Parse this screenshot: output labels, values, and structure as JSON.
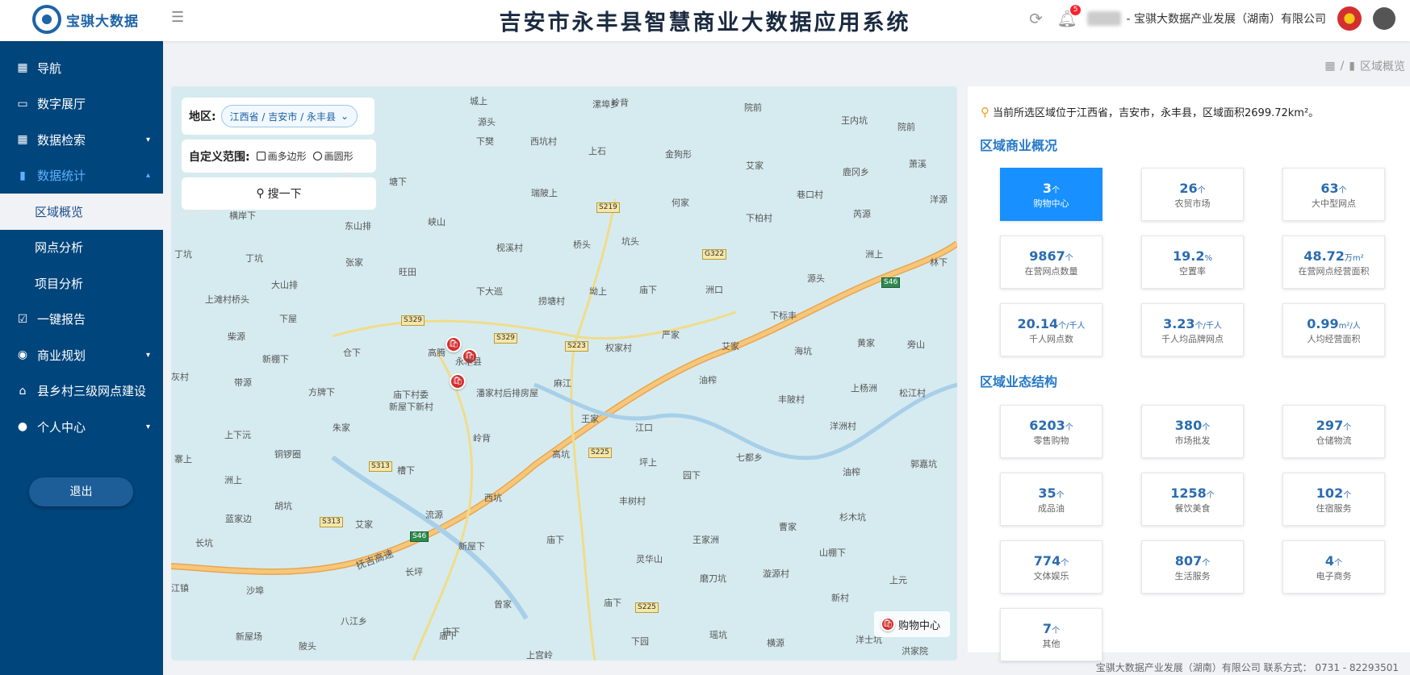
{
  "header": {
    "logo_text": "宝骐大数据",
    "title": "吉安市永丰县智慧商业大数据应用系统",
    "notification_count": "5",
    "company": "- 宝骐大数据产业发展（湖南）有限公司"
  },
  "sidebar": {
    "items": [
      {
        "label": "导航",
        "icon": "grid-icon"
      },
      {
        "label": "数字展厅",
        "icon": "monitor-icon"
      },
      {
        "label": "数据检索",
        "icon": "grid-search-icon",
        "chevron": "down"
      },
      {
        "label": "数据统计",
        "icon": "bar-chart-icon",
        "chevron": "up",
        "open": true
      },
      {
        "label": "区域概览",
        "sub": true,
        "active": true
      },
      {
        "label": "网点分析",
        "sub": true
      },
      {
        "label": "项目分析",
        "sub": true
      },
      {
        "label": "一键报告",
        "icon": "clipboard-check-icon"
      },
      {
        "label": "商业规划",
        "icon": "location-icon",
        "chevron": "down"
      },
      {
        "label": "县乡村三级网点建设",
        "icon": "bank-icon"
      },
      {
        "label": "个人中心",
        "icon": "user-icon",
        "chevron": "down"
      }
    ],
    "logout_label": "退出"
  },
  "breadcrumb": {
    "current": "区域概览"
  },
  "map": {
    "region_label": "地区:",
    "region_value": "江西省 / 吉安市 / 永丰县",
    "custom_range_label": "自定义范围:",
    "polygon_label": "画多边形",
    "circle_label": "画圆形",
    "search_label": "搜一下",
    "legend_label": "购物中心",
    "place_labels": [
      "城上",
      "岭背",
      "院前",
      "王内坑",
      "院前",
      "源头",
      "漯埠乡",
      "西坑村",
      "上石",
      "金狗形",
      "艾家",
      "鹿冈乡",
      "萧溪",
      "下樊",
      "瑞陂上",
      "何家",
      "巷口村",
      "芮源",
      "洋源",
      "塘下",
      "峡山",
      "枧溪村",
      "桥头",
      "坑头",
      "下柏村",
      "东山排",
      "旺田",
      "洲上",
      "林下",
      "丁坑",
      "张家",
      "下大巡",
      "捞塘村",
      "坳上",
      "庙下",
      "洲口",
      "源头",
      "大山排",
      "上滩村桥头",
      "下屋",
      "高腾",
      "永丰县",
      "下标丰",
      "权家村",
      "严家",
      "艾家",
      "黄家",
      "旁山",
      "柴源",
      "新棚下",
      "仓下",
      "海坑",
      "带源",
      "方牌下",
      "庙下村委",
      "麻江",
      "油榨",
      "上杨洲",
      "松江村",
      "新屋下新村",
      "潘家村后排房屋",
      "丰陂村",
      "朱家",
      "王家",
      "洋洲村",
      "江口",
      "上下沅",
      "铜锣圈",
      "岭背",
      "七都乡",
      "寨上",
      "槽下",
      "高坑",
      "坪上",
      "郭嘉坑",
      "园下",
      "油榨",
      "洲上",
      "胡坑",
      "西坑",
      "丰树村",
      "流源",
      "杉木坑",
      "曹家",
      "蓝家边",
      "艾家",
      "新屋下",
      "庙下",
      "王家洲",
      "长坑",
      "灵华山",
      "山棚下",
      "磨刀坑",
      "漩源村",
      "长坪",
      "上元",
      "江镇",
      "沙埠",
      "曾家",
      "庙下",
      "新村",
      "八江乡",
      "庙下",
      "瑶坑",
      "新屋场",
      "陂头",
      "庙下",
      "上宫岭",
      "下园",
      "横源",
      "洋士坑",
      "洪家院",
      "丁坑",
      "横岸下",
      "灰村"
    ],
    "road_tags": [
      "S219",
      "G322",
      "S329",
      "S329",
      "S223",
      "S225",
      "S313",
      "S313",
      "S225",
      "S46",
      "S46"
    ],
    "highway_label": "抚吉高速"
  },
  "panel": {
    "location_text": "当前所选区域位于江西省，吉安市，永丰县，区域面积2699.72km²。",
    "section1_title": "区域商业概况",
    "section2_title": "区域业态结构",
    "overview_cards": [
      {
        "value": "3",
        "unit": "个",
        "label": "购物中心",
        "highlight": true
      },
      {
        "value": "26",
        "unit": "个",
        "label": "农贸市场"
      },
      {
        "value": "63",
        "unit": "个",
        "label": "大中型网点"
      },
      {
        "value": "9867",
        "unit": "个",
        "label": "在营网点数量"
      },
      {
        "value": "19.2",
        "unit": "%",
        "label": "空置率"
      },
      {
        "value": "48.72",
        "unit": "万m²",
        "label": "在营网点经营面积"
      },
      {
        "value": "20.14",
        "unit": "个/千人",
        "label": "千人网点数"
      },
      {
        "value": "3.23",
        "unit": "个/千人",
        "label": "千人均品牌网点"
      },
      {
        "value": "0.99",
        "unit": "m²/人",
        "label": "人均经营面积"
      }
    ],
    "structure_cards": [
      {
        "value": "6203",
        "unit": "个",
        "label": "零售购物"
      },
      {
        "value": "380",
        "unit": "个",
        "label": "市场批发"
      },
      {
        "value": "297",
        "unit": "个",
        "label": "仓储物流"
      },
      {
        "value": "35",
        "unit": "个",
        "label": "成品油"
      },
      {
        "value": "1258",
        "unit": "个",
        "label": "餐饮美食"
      },
      {
        "value": "102",
        "unit": "个",
        "label": "住宿服务"
      },
      {
        "value": "774",
        "unit": "个",
        "label": "文体娱乐"
      },
      {
        "value": "807",
        "unit": "个",
        "label": "生活服务"
      },
      {
        "value": "4",
        "unit": "个",
        "label": "电子商务"
      },
      {
        "value": "7",
        "unit": "个",
        "label": "其他"
      }
    ]
  },
  "footer": {
    "text": "宝骐大数据产业发展（湖南）有限公司 联系方式： 0731 - 82293501"
  }
}
